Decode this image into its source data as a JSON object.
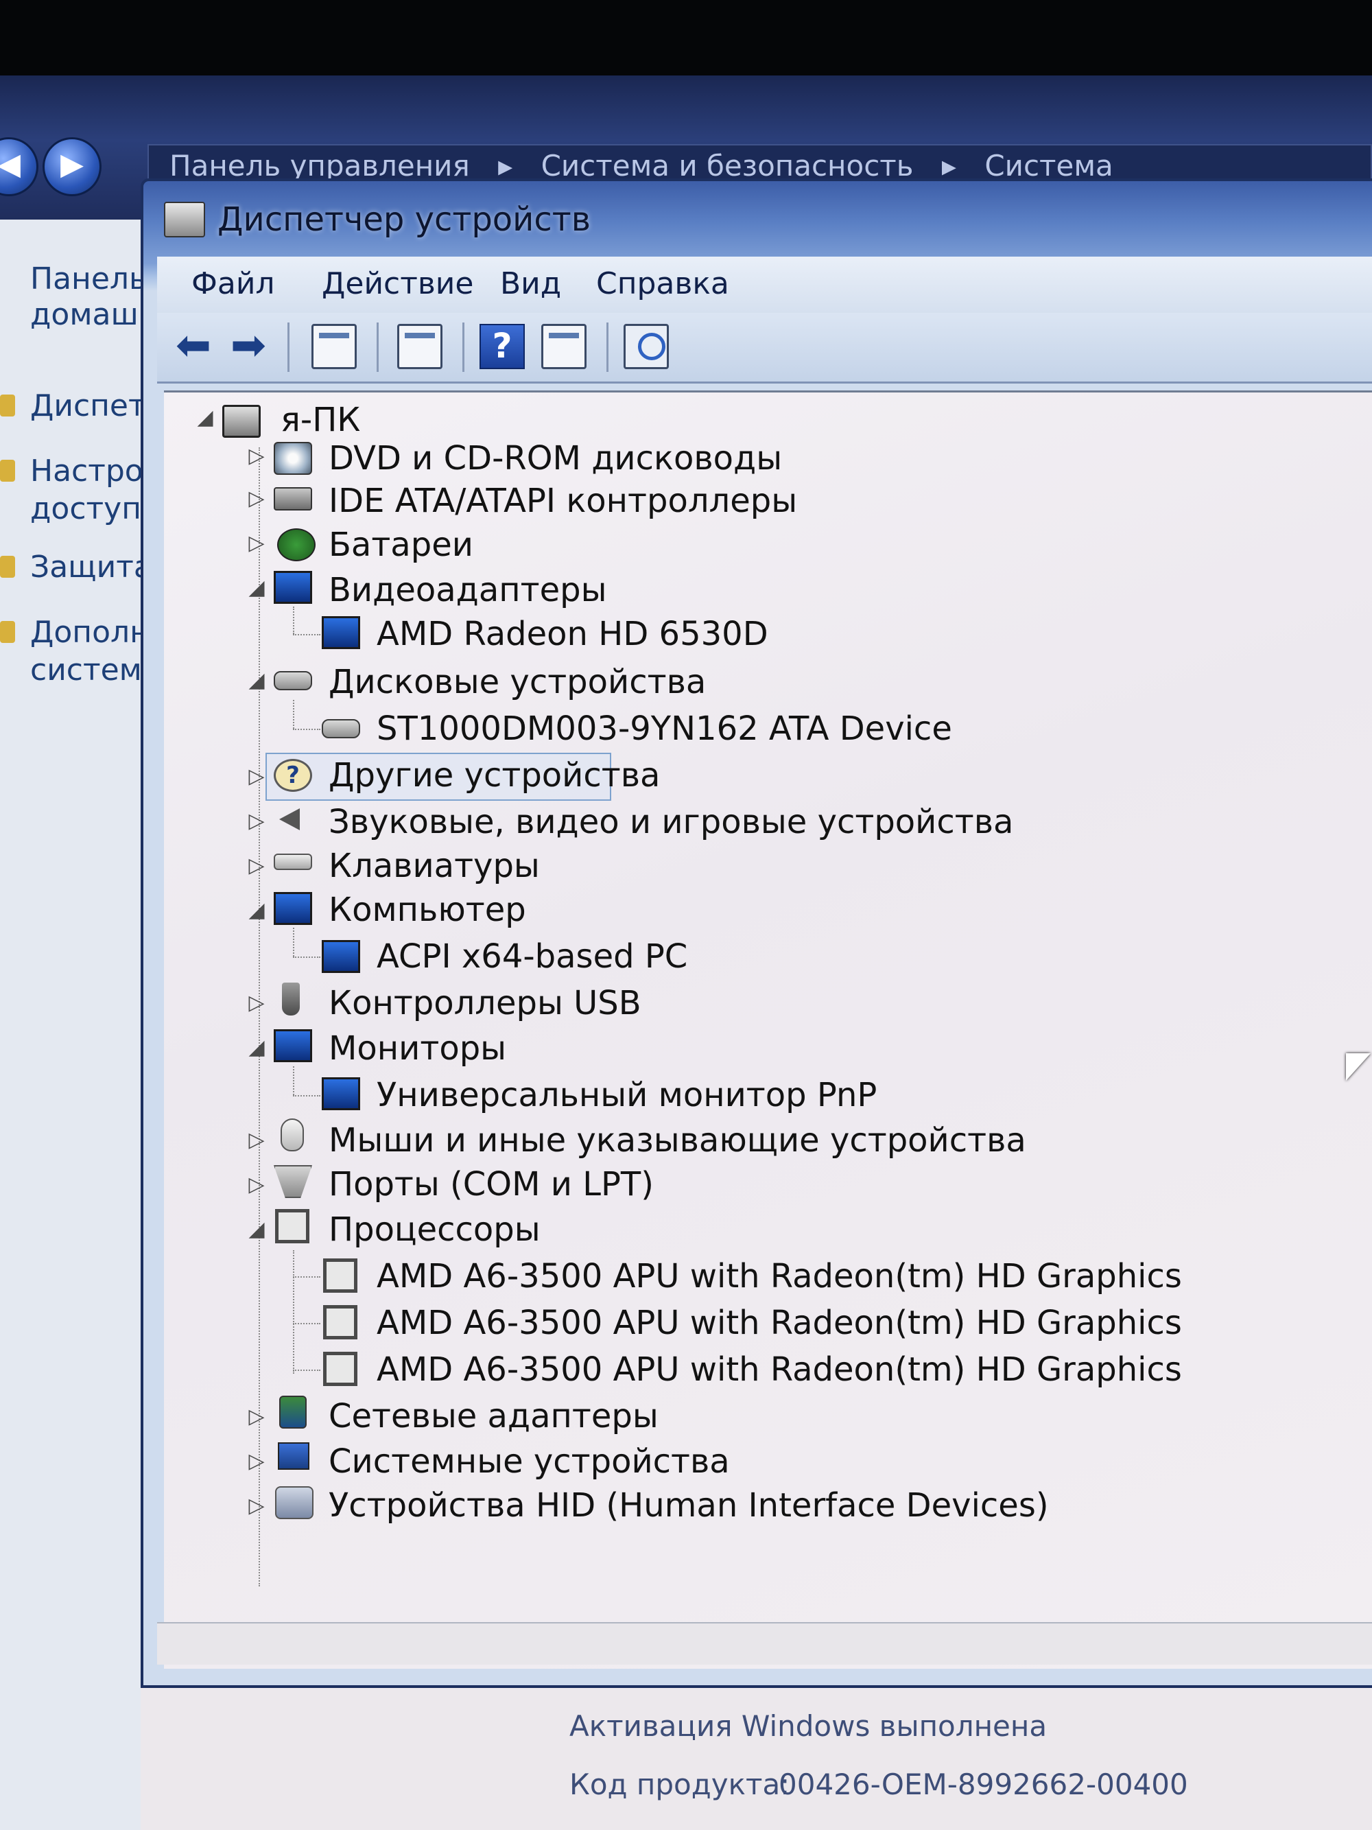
{
  "breadcrumb": [
    "Панель управления",
    "Система и безопасность",
    "Система"
  ],
  "left_panel": {
    "items": [
      "Панель",
      "домаш",
      "Диспет",
      "Настро",
      "доступа",
      "Защита",
      "Дополн",
      "систем"
    ]
  },
  "window": {
    "title": "Диспетчер устройств",
    "menu": [
      "Файл",
      "Действие",
      "Вид",
      "Справка"
    ],
    "toolbar": {
      "back_icon": "back-arrow-icon",
      "forward_icon": "forward-arrow-icon",
      "help_glyph": "?"
    }
  },
  "tree": {
    "root": "я-ПК",
    "categories": [
      {
        "label": "DVD и CD-ROM дисководы",
        "expanded": false,
        "icon": "dvd-icon"
      },
      {
        "label": "IDE ATA/ATAPI контроллеры",
        "expanded": false,
        "icon": "ide-controller-icon"
      },
      {
        "label": "Батареи",
        "expanded": false,
        "icon": "battery-icon"
      },
      {
        "label": "Видеоадаптеры",
        "expanded": true,
        "icon": "display-adapter-icon",
        "children": [
          "AMD Radeon HD 6530D"
        ]
      },
      {
        "label": "Дисковые устройства",
        "expanded": true,
        "icon": "disk-drive-icon",
        "children": [
          "ST1000DM003-9YN162 ATA Device"
        ]
      },
      {
        "label": "Другие устройства",
        "expanded": false,
        "selected": true,
        "icon": "unknown-device-icon"
      },
      {
        "label": "Звуковые, видео и игровые устройства",
        "expanded": false,
        "icon": "speaker-icon"
      },
      {
        "label": "Клавиатуры",
        "expanded": false,
        "icon": "keyboard-icon"
      },
      {
        "label": "Компьютер",
        "expanded": true,
        "icon": "computer-icon",
        "children": [
          "ACPI x64-based PC"
        ]
      },
      {
        "label": "Контроллеры USB",
        "expanded": false,
        "icon": "usb-icon"
      },
      {
        "label": "Мониторы",
        "expanded": true,
        "icon": "monitor-icon",
        "children": [
          "Универсальный монитор PnP"
        ]
      },
      {
        "label": "Мыши и иные указывающие устройства",
        "expanded": false,
        "icon": "mouse-icon"
      },
      {
        "label": "Порты (COM и LPT)",
        "expanded": false,
        "icon": "port-icon"
      },
      {
        "label": "Процессоры",
        "expanded": true,
        "icon": "processor-icon",
        "children": [
          "AMD A6-3500 APU with Radeon(tm) HD Graphics",
          "AMD A6-3500 APU with Radeon(tm) HD Graphics",
          "AMD A6-3500 APU with Radeon(tm) HD Graphics"
        ]
      },
      {
        "label": "Сетевые адаптеры",
        "expanded": false,
        "icon": "network-adapter-icon"
      },
      {
        "label": "Системные устройства",
        "expanded": false,
        "icon": "system-devices-icon"
      },
      {
        "label": "Устройства HID (Human Interface Devices)",
        "expanded": false,
        "icon": "hid-icon"
      }
    ]
  },
  "activation": {
    "status": "Активация Windows выполнена",
    "product_key_label": "Код продукта:",
    "product_key": "00426-OEM-8992662-00400"
  }
}
